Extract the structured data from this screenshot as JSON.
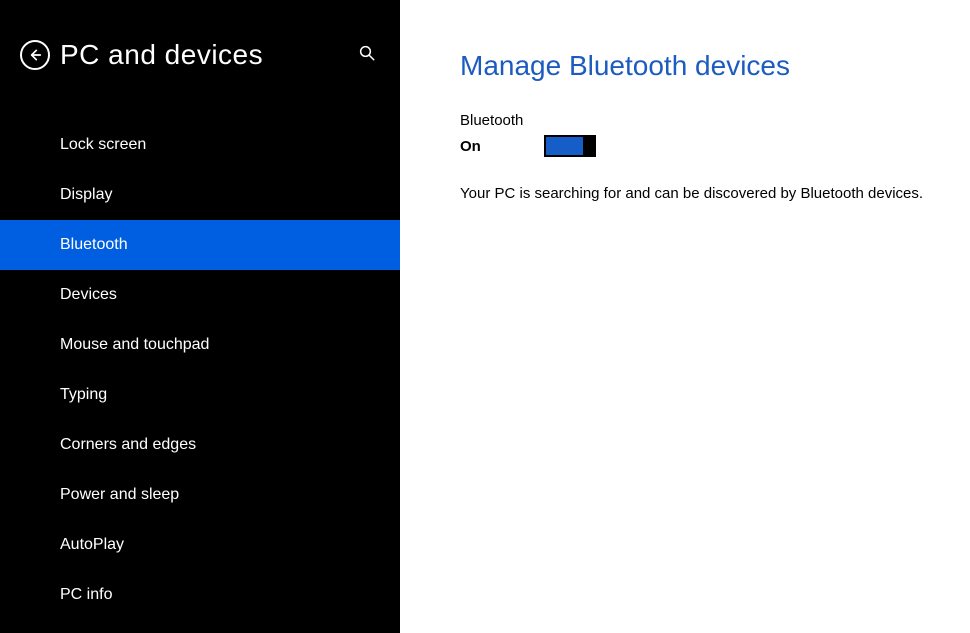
{
  "sidebar": {
    "title": "PC and devices",
    "items": [
      {
        "label": "Lock screen",
        "selected": false
      },
      {
        "label": "Display",
        "selected": false
      },
      {
        "label": "Bluetooth",
        "selected": true
      },
      {
        "label": "Devices",
        "selected": false
      },
      {
        "label": "Mouse and touchpad",
        "selected": false
      },
      {
        "label": "Typing",
        "selected": false
      },
      {
        "label": "Corners and edges",
        "selected": false
      },
      {
        "label": "Power and sleep",
        "selected": false
      },
      {
        "label": "AutoPlay",
        "selected": false
      },
      {
        "label": "PC info",
        "selected": false
      }
    ]
  },
  "content": {
    "title": "Manage Bluetooth devices",
    "toggle": {
      "label": "Bluetooth",
      "state_text": "On",
      "state": true
    },
    "status_text": "Your PC is searching for and can be discovered by Bluetooth devices."
  },
  "colors": {
    "accent": "#005fe0",
    "title_blue": "#1c5bbf"
  }
}
